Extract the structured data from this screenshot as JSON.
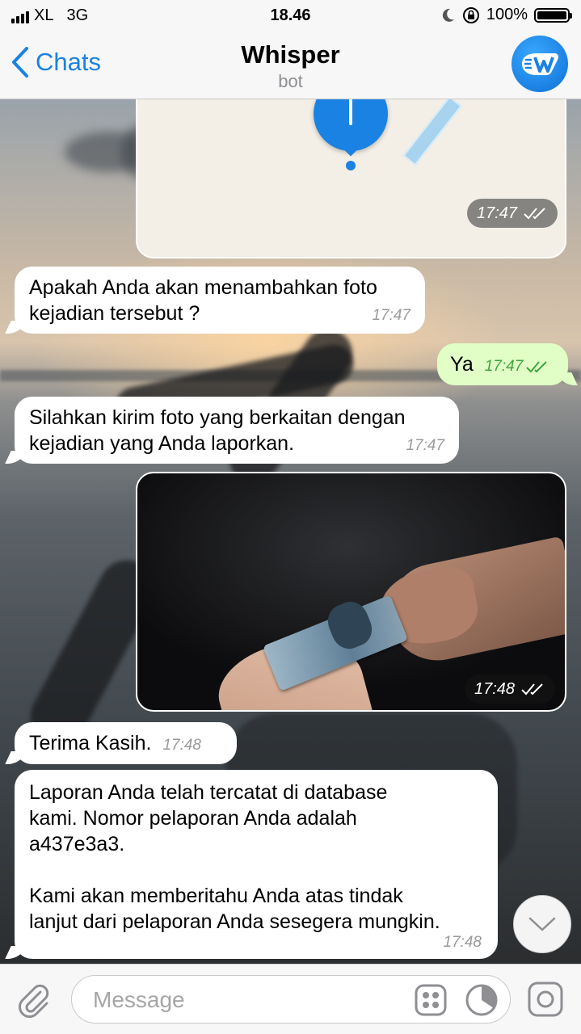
{
  "status_bar": {
    "carrier": "XL",
    "network": "3G",
    "time": "18.46",
    "battery": "100%"
  },
  "nav": {
    "back_label": "Chats",
    "title": "Whisper",
    "subtitle": "bot"
  },
  "messages": {
    "location": {
      "time": "17:47"
    },
    "m1": {
      "text": "Apakah Anda akan menambahkan foto kejadian tersebut ?",
      "line1": "Apakah Anda akan menambahkan foto",
      "line2": "kejadian tersebut ?",
      "time": "17:47"
    },
    "m2": {
      "text": "Ya",
      "time": "17:47"
    },
    "m3": {
      "line1": "Silahkan kirim foto yang berkaitan dengan",
      "line2": "kejadian yang Anda laporkan.",
      "time": "17:47"
    },
    "photo": {
      "time": "17:48"
    },
    "m4": {
      "text": "Terima Kasih.",
      "time": "17:48"
    },
    "m5": {
      "line1": "Laporan Anda telah tercatat di database",
      "line2": "kami. Nomor pelaporan Anda adalah",
      "line3": "a437e3a3.",
      "line4": "Kami akan memberitahu Anda atas tindak",
      "line5": "lanjut dari pelaporan Anda sesegera mungkin.",
      "time": "17:48"
    }
  },
  "input": {
    "placeholder": "Message"
  },
  "colors": {
    "accent": "#1a82e2",
    "outgoing_bubble": "#e1fec6",
    "incoming_bubble": "#ffffff"
  }
}
